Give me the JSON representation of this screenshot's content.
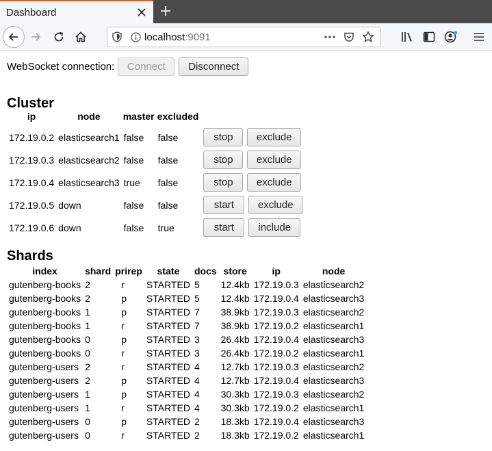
{
  "browser": {
    "tab_title": "Dashboard",
    "url_host": "localhost",
    "url_port": ":9091"
  },
  "websocket": {
    "label": "WebSocket connection:",
    "connect_label": "Connect",
    "disconnect_label": "Disconnect"
  },
  "cluster": {
    "heading": "Cluster",
    "headers": [
      "ip",
      "node",
      "master",
      "excluded"
    ],
    "rows": [
      {
        "ip": "172.19.0.2",
        "node": "elasticsearch1",
        "master": "false",
        "excluded": "false",
        "action1": "stop",
        "action2": "exclude"
      },
      {
        "ip": "172.19.0.3",
        "node": "elasticsearch2",
        "master": "false",
        "excluded": "false",
        "action1": "stop",
        "action2": "exclude"
      },
      {
        "ip": "172.19.0.4",
        "node": "elasticsearch3",
        "master": "true",
        "excluded": "false",
        "action1": "stop",
        "action2": "exclude"
      },
      {
        "ip": "172.19.0.5",
        "node": "down",
        "master": "false",
        "excluded": "false",
        "action1": "start",
        "action2": "exclude"
      },
      {
        "ip": "172.19.0.6",
        "node": "down",
        "master": "false",
        "excluded": "true",
        "action1": "start",
        "action2": "include"
      }
    ]
  },
  "shards": {
    "heading": "Shards",
    "headers": [
      "index",
      "shard",
      "prirep",
      "state",
      "docs",
      "store",
      "ip",
      "node"
    ],
    "rows": [
      [
        "gutenberg-books",
        "2",
        "r",
        "STARTED",
        "5",
        "12.4kb",
        "172.19.0.3",
        "elasticsearch2"
      ],
      [
        "gutenberg-books",
        "2",
        "p",
        "STARTED",
        "5",
        "12.4kb",
        "172.19.0.4",
        "elasticsearch3"
      ],
      [
        "gutenberg-books",
        "1",
        "p",
        "STARTED",
        "7",
        "38.9kb",
        "172.19.0.3",
        "elasticsearch2"
      ],
      [
        "gutenberg-books",
        "1",
        "r",
        "STARTED",
        "7",
        "38.9kb",
        "172.19.0.2",
        "elasticsearch1"
      ],
      [
        "gutenberg-books",
        "0",
        "p",
        "STARTED",
        "3",
        "26.4kb",
        "172.19.0.4",
        "elasticsearch3"
      ],
      [
        "gutenberg-books",
        "0",
        "r",
        "STARTED",
        "3",
        "26.4kb",
        "172.19.0.2",
        "elasticsearch1"
      ],
      [
        "gutenberg-users",
        "2",
        "r",
        "STARTED",
        "4",
        "12.7kb",
        "172.19.0.3",
        "elasticsearch2"
      ],
      [
        "gutenberg-users",
        "2",
        "p",
        "STARTED",
        "4",
        "12.7kb",
        "172.19.0.4",
        "elasticsearch3"
      ],
      [
        "gutenberg-users",
        "1",
        "p",
        "STARTED",
        "4",
        "30.3kb",
        "172.19.0.3",
        "elasticsearch2"
      ],
      [
        "gutenberg-users",
        "1",
        "r",
        "STARTED",
        "4",
        "30.3kb",
        "172.19.0.2",
        "elasticsearch1"
      ],
      [
        "gutenberg-users",
        "0",
        "p",
        "STARTED",
        "2",
        "18.3kb",
        "172.19.0.4",
        "elasticsearch3"
      ],
      [
        "gutenberg-users",
        "0",
        "r",
        "STARTED",
        "2",
        "18.3kb",
        "172.19.0.2",
        "elasticsearch1"
      ]
    ]
  },
  "icons": {
    "tab_close": "close-icon",
    "new_tab": "plus-icon",
    "back": "arrow-left-icon",
    "forward": "arrow-right-icon",
    "reload": "reload-icon",
    "home": "home-icon",
    "tracking": "shield-icon",
    "site_info": "info-icon",
    "page_actions": "more-icon",
    "pocket": "pocket-icon",
    "bookmark": "star-icon",
    "library": "library-icon",
    "sidebar": "sidebar-icon",
    "account": "account-icon",
    "menu": "hamburger-icon"
  },
  "colors": {
    "tab_accent": "#e85d17",
    "tab_strip": "#4a4a4a",
    "account_dot": "#45a1ff"
  }
}
